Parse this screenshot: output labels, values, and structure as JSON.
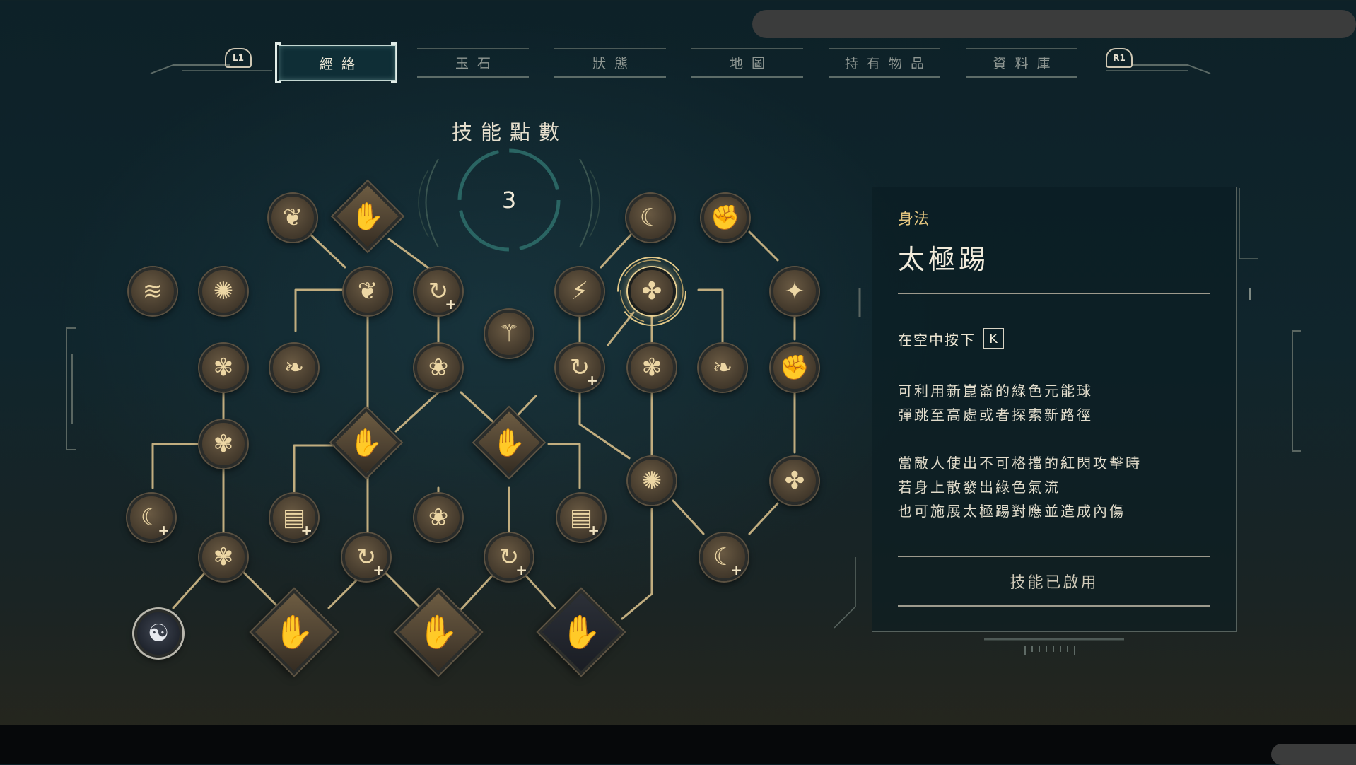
{
  "nav": {
    "left_bumper": "L1",
    "right_bumper": "R1",
    "tabs": [
      {
        "label": "經絡",
        "active": true
      },
      {
        "label": "玉石",
        "active": false
      },
      {
        "label": "狀態",
        "active": false
      },
      {
        "label": "地圖",
        "active": false
      },
      {
        "label": "持有物品",
        "active": false
      },
      {
        "label": "資料庫",
        "active": false
      }
    ]
  },
  "skill_points": {
    "label": "技能點數",
    "value": "3"
  },
  "tree": {
    "nodes": [
      {
        "id": "n1",
        "icon": "wind-glide-icon",
        "glyph": "❦",
        "plus": false,
        "type": "circle"
      },
      {
        "id": "n2",
        "icon": "fire-palm-icon",
        "glyph": "✋",
        "plus": false,
        "type": "diamond"
      },
      {
        "id": "n3",
        "icon": "crescent-kick-icon",
        "glyph": "☾",
        "plus": false,
        "type": "circle"
      },
      {
        "id": "n4",
        "icon": "fist-strike-icon",
        "glyph": "✊",
        "plus": false,
        "type": "circle"
      },
      {
        "id": "n5",
        "icon": "wind-dash-icon",
        "glyph": "≋",
        "plus": false,
        "type": "circle"
      },
      {
        "id": "n6",
        "icon": "kick-strike-icon",
        "glyph": "✺",
        "plus": false,
        "type": "circle"
      },
      {
        "id": "n7",
        "icon": "wind-slash-icon",
        "glyph": "❦",
        "plus": false,
        "type": "circle"
      },
      {
        "id": "n8",
        "icon": "cycle-plus-icon",
        "glyph": "↻",
        "plus": true,
        "type": "circle"
      },
      {
        "id": "n9",
        "icon": "spiral-step-icon",
        "glyph": "⚚",
        "plus": false,
        "type": "circle"
      },
      {
        "id": "n10",
        "icon": "lightning-fist-icon",
        "glyph": "⚡",
        "plus": false,
        "type": "circle"
      },
      {
        "id": "n11",
        "icon": "taiji-kick-icon",
        "glyph": "✤",
        "plus": false,
        "type": "circle",
        "selected": true
      },
      {
        "id": "n12",
        "icon": "sweep-kick-icon",
        "glyph": "✦",
        "plus": false,
        "type": "circle"
      },
      {
        "id": "n13",
        "icon": "flower-burst-icon",
        "glyph": "✾",
        "plus": false,
        "type": "circle"
      },
      {
        "id": "n14",
        "icon": "bird-strike-icon",
        "glyph": "❧",
        "plus": false,
        "type": "circle"
      },
      {
        "id": "n15",
        "icon": "lotus-icon",
        "glyph": "❀",
        "plus": false,
        "type": "circle"
      },
      {
        "id": "n16",
        "icon": "cycle-plus-icon",
        "glyph": "↻",
        "plus": true,
        "type": "circle"
      },
      {
        "id": "n17",
        "icon": "spin-kick-icon",
        "glyph": "✾",
        "plus": false,
        "type": "circle"
      },
      {
        "id": "n18",
        "icon": "low-kick-icon",
        "glyph": "❧",
        "plus": false,
        "type": "circle"
      },
      {
        "id": "n19",
        "icon": "wave-fist-icon",
        "glyph": "✊",
        "plus": false,
        "type": "circle"
      },
      {
        "id": "n20",
        "icon": "flower-strike-icon",
        "glyph": "✾",
        "plus": false,
        "type": "circle"
      },
      {
        "id": "n21",
        "icon": "palm-mushroom-icon",
        "glyph": "✋",
        "plus": false,
        "type": "diamond"
      },
      {
        "id": "n22",
        "icon": "palm-flame-icon",
        "glyph": "✋",
        "plus": false,
        "type": "diamond"
      },
      {
        "id": "n23",
        "icon": "crescent-plus-icon",
        "glyph": "☾",
        "plus": true,
        "type": "circle"
      },
      {
        "id": "n24",
        "icon": "talisman-plus-icon",
        "glyph": "▤",
        "plus": true,
        "type": "circle"
      },
      {
        "id": "n25",
        "icon": "lotus-bloom-icon",
        "glyph": "❀",
        "plus": false,
        "type": "circle"
      },
      {
        "id": "n26",
        "icon": "talisman-plus-icon",
        "glyph": "▤",
        "plus": true,
        "type": "circle"
      },
      {
        "id": "n27",
        "icon": "whirl-kick-icon",
        "glyph": "✺",
        "plus": false,
        "type": "circle"
      },
      {
        "id": "n28",
        "icon": "split-kick-icon",
        "glyph": "✤",
        "plus": false,
        "type": "circle"
      },
      {
        "id": "n29",
        "icon": "flower-spin-icon",
        "glyph": "✾",
        "plus": false,
        "type": "circle"
      },
      {
        "id": "n30",
        "icon": "cycle-plus-icon",
        "glyph": "↻",
        "plus": true,
        "type": "circle"
      },
      {
        "id": "n31",
        "icon": "cycle-plus-icon",
        "glyph": "↻",
        "plus": true,
        "type": "circle"
      },
      {
        "id": "n32",
        "icon": "crescent-plus-icon",
        "glyph": "☾",
        "plus": true,
        "type": "circle"
      },
      {
        "id": "n33",
        "icon": "yin-yang-swirl-icon",
        "glyph": "☯",
        "plus": false,
        "type": "dark"
      },
      {
        "id": "n34",
        "icon": "palm-mushroom-icon",
        "glyph": "✋",
        "plus": false,
        "type": "diamond-big"
      },
      {
        "id": "n35",
        "icon": "palm-flame-icon",
        "glyph": "✋",
        "plus": false,
        "type": "diamond-big"
      },
      {
        "id": "n36",
        "icon": "white-flame-palm-icon",
        "glyph": "✋",
        "plus": false,
        "type": "diamond-big-light"
      }
    ]
  },
  "detail": {
    "category": "身法",
    "title": "太極踢",
    "input_prefix": "在空中按下",
    "input_key": "K",
    "desc1": [
      "可利用新崑崙的綠色元能球",
      "彈跳至高處或者探索新路徑"
    ],
    "desc2": [
      "當敵人使出不可格擋的紅閃攻擊時",
      "若身上散發出綠色氣流",
      "也可施展太極踢對應並造成內傷"
    ],
    "status": "技能已啟用"
  }
}
